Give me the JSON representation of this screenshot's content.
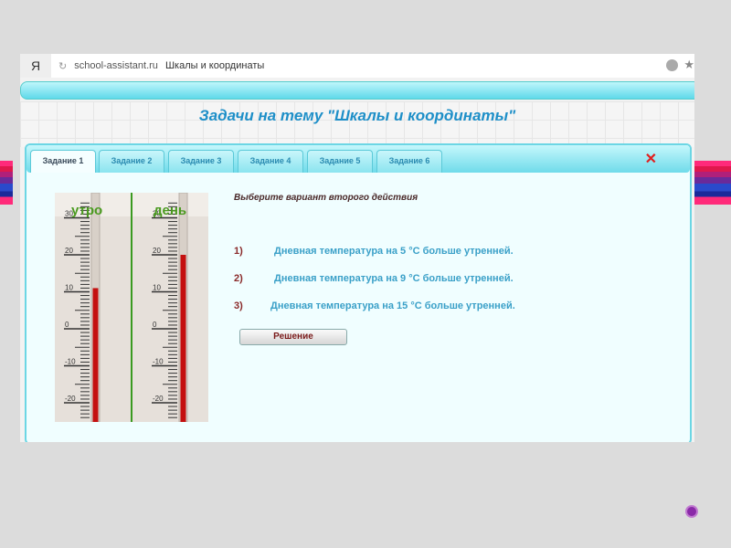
{
  "browser": {
    "logo": "Я",
    "url": "school-assistant.ru",
    "page_title": "Шкалы и координаты"
  },
  "header": {
    "title": "Задачи на тему \"Шкалы и координаты\""
  },
  "tabs": [
    {
      "label": "Задание 1",
      "active": true
    },
    {
      "label": "Задание 2"
    },
    {
      "label": "Задание 3"
    },
    {
      "label": "Задание 4"
    },
    {
      "label": "Задание 5"
    },
    {
      "label": "Задание 6"
    }
  ],
  "close_label": "✕",
  "thermometers": {
    "scale_labels": [
      "30",
      "20",
      "10",
      "0",
      "-10",
      "-20"
    ],
    "morning": {
      "label": "утро",
      "value": 11
    },
    "day": {
      "label": "день",
      "value": 20
    }
  },
  "question": "Выберите вариант второго действия",
  "options": [
    {
      "num": "1)",
      "text": "Дневная температура на 5 °С  больше утренней."
    },
    {
      "num": "2)",
      "text": "Дневная температура на 9 °С  больше утренней."
    },
    {
      "num": "3)",
      "text": "Дневная температура на 15 °С  больше утренней."
    }
  ],
  "solve_button": "Решение",
  "colors": {
    "accent": "#1e8fc8",
    "mercury": "#c41010",
    "label_green": "#4a9a20"
  }
}
